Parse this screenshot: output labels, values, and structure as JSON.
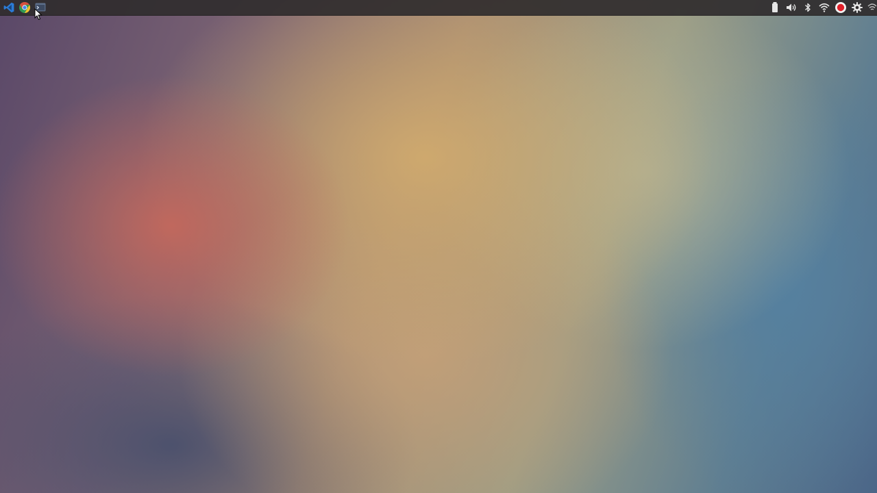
{
  "desktop": {
    "wallpaper_colors": [
      "#5a4868",
      "#c4685c",
      "#d0aa6e",
      "#b0b296",
      "#5480a0",
      "#4b6688"
    ]
  },
  "top_panel": {
    "background_color": "#302c2e",
    "launcher_icons": [
      {
        "name": "vscode-icon",
        "color": "#2b7bd6"
      },
      {
        "name": "chrome-icon",
        "color": "#d9503f"
      },
      {
        "name": "terminal-icon",
        "color": "#5d6f8a"
      }
    ],
    "tray_icons": [
      {
        "name": "battery-icon"
      },
      {
        "name": "volume-icon"
      },
      {
        "name": "bluetooth-icon"
      },
      {
        "name": "wifi-icon"
      },
      {
        "name": "record-icon",
        "color": "#e0202a"
      },
      {
        "name": "settings-icon"
      },
      {
        "name": "network-icon"
      }
    ]
  }
}
